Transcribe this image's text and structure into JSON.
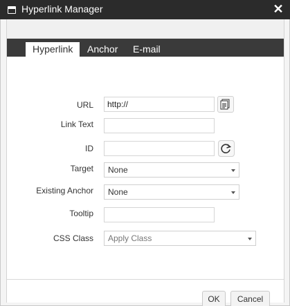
{
  "window": {
    "title": "Hyperlink Manager",
    "close_icon": "close-icon",
    "window_icon": "window-icon"
  },
  "tabs": [
    {
      "label": "Hyperlink",
      "active": true
    },
    {
      "label": "Anchor",
      "active": false
    },
    {
      "label": "E-mail",
      "active": false
    }
  ],
  "form": {
    "url": {
      "label": "URL",
      "value": "http://",
      "button_icon": "document-manager-icon"
    },
    "link_text": {
      "label": "Link Text",
      "value": ""
    },
    "id": {
      "label": "ID",
      "value": "",
      "button_icon": "refresh-icon"
    },
    "target": {
      "label": "Target",
      "value": "None"
    },
    "existing_anchor": {
      "label": "Existing Anchor",
      "value": "None"
    },
    "tooltip": {
      "label": "Tooltip",
      "value": ""
    },
    "css_class": {
      "label": "CSS Class",
      "value": "Apply Class"
    }
  },
  "footer": {
    "ok_label": "OK",
    "cancel_label": "Cancel"
  },
  "colors": {
    "titlebar": "#2b2b2b",
    "tabbar": "#3a3a3a",
    "active_tab": "#ffffff"
  }
}
